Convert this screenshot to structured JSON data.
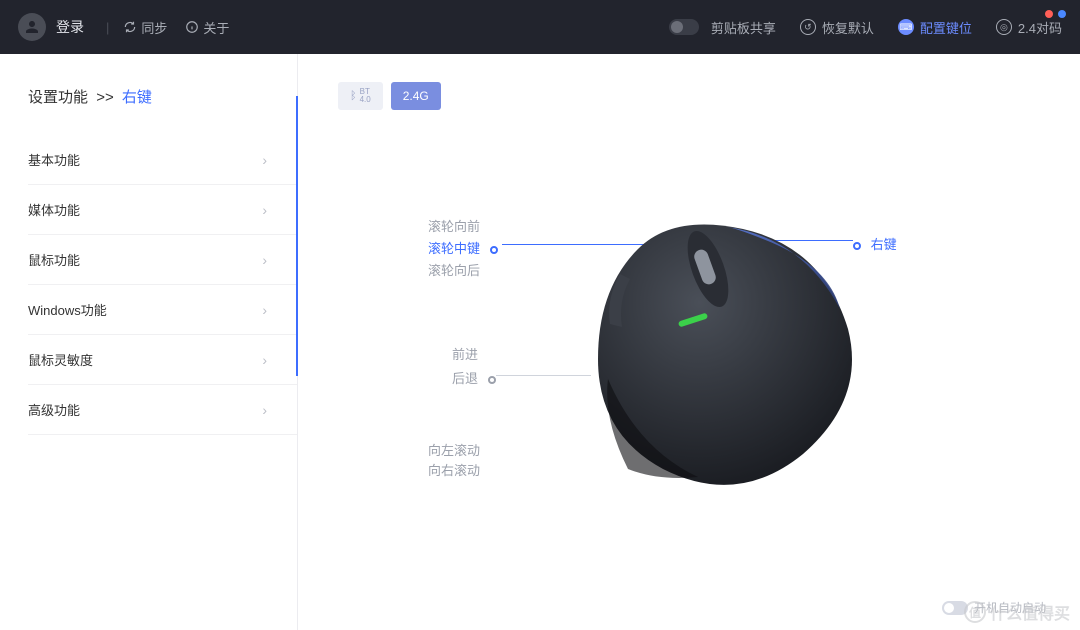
{
  "topbar": {
    "login": "登录",
    "sync": "同步",
    "about": "关于",
    "clipboard_share": "剪贴板共享",
    "restore_default": "恢复默认",
    "configure_keys": "配置键位",
    "pairing_24g": "2.4对码"
  },
  "sidebar": {
    "title_prefix": "设置功能",
    "separator": ">>",
    "current": "右键",
    "items": [
      {
        "label": "基本功能"
      },
      {
        "label": "媒体功能"
      },
      {
        "label": "鼠标功能"
      },
      {
        "label": "Windows功能"
      },
      {
        "label": "鼠标灵敏度"
      },
      {
        "label": "高级功能"
      }
    ]
  },
  "connection": {
    "bluetooth_label": "BT",
    "bluetooth_sub": "4.0",
    "g24_label": "2.4G"
  },
  "mouse_labels": {
    "scroll_forward": "滚轮向前",
    "scroll_middle": "滚轮中键",
    "scroll_back": "滚轮向后",
    "forward": "前进",
    "back": "后退",
    "tilt_left": "向左滚动",
    "tilt_right": "向右滚动",
    "right_click": "右键"
  },
  "footer": {
    "autostart": "开机自动启动"
  },
  "watermark": {
    "badge": "值",
    "text": "什么值得买"
  }
}
